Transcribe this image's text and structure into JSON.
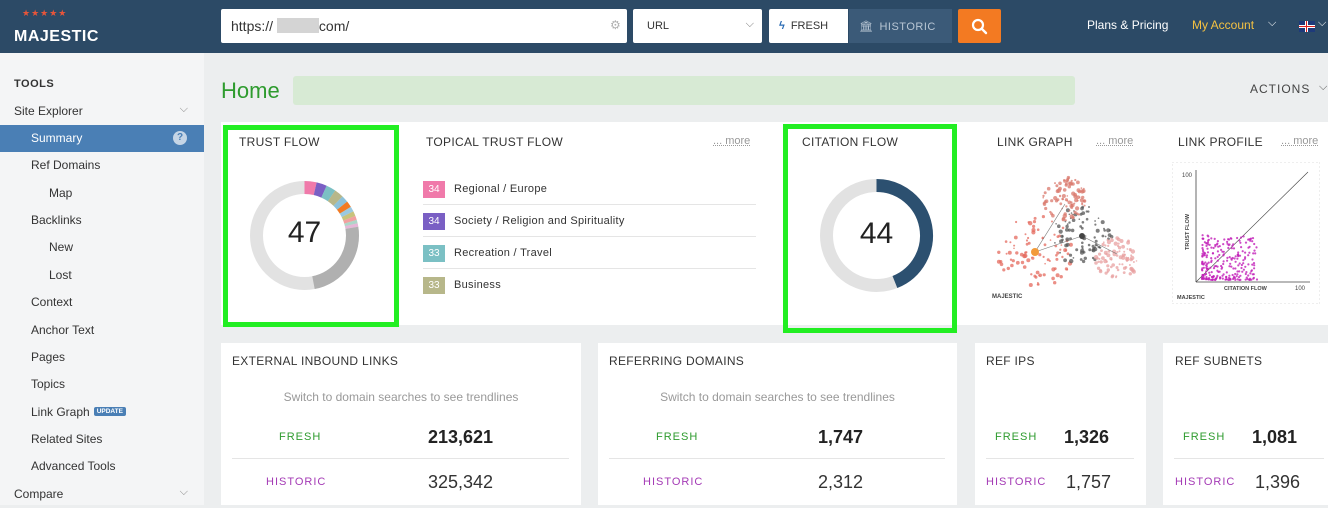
{
  "brand": {
    "name": "MAJESTIC"
  },
  "search": {
    "url_value": "https://           .com/",
    "url_prefix": "https://",
    "url_suffix": ".com/",
    "mode": "URL",
    "fresh_label": "FRESH",
    "historic_label": "HISTORIC"
  },
  "nav": {
    "plans": "Plans & Pricing",
    "account": "My Account"
  },
  "colors": {
    "topbar": "#2c4a66",
    "accent_orange": "#f37a22",
    "fresh_green": "#2e9b2e",
    "historic_purple": "#a43ab5",
    "active_blue": "#4a7fb5",
    "citation_navy": "#2c5070",
    "highlight": "#22ee22"
  },
  "sidebar": {
    "heading": "TOOLS",
    "items": [
      {
        "label": "Site Explorer"
      },
      {
        "label": "Summary"
      },
      {
        "label": "Ref Domains"
      },
      {
        "label": "Map"
      },
      {
        "label": "Backlinks"
      },
      {
        "label": "New"
      },
      {
        "label": "Lost"
      },
      {
        "label": "Context"
      },
      {
        "label": "Anchor Text"
      },
      {
        "label": "Pages"
      },
      {
        "label": "Topics"
      },
      {
        "label": "Link Graph",
        "badge": "UPDATE"
      },
      {
        "label": "Related Sites"
      },
      {
        "label": "Advanced Tools"
      },
      {
        "label": "Compare"
      }
    ]
  },
  "page": {
    "title": "Home",
    "actions": "ACTIONS"
  },
  "trust_flow": {
    "label": "TRUST FLOW",
    "value": "47"
  },
  "topical_trust_flow": {
    "label": "TOPICAL TRUST FLOW",
    "more": "... more",
    "items": [
      {
        "score": "34",
        "topic": "Regional / Europe",
        "color": "#f07aaa"
      },
      {
        "score": "34",
        "topic": "Society / Religion and Spirituality",
        "color": "#7a5fc4"
      },
      {
        "score": "33",
        "topic": "Recreation / Travel",
        "color": "#7bc0c4"
      },
      {
        "score": "33",
        "topic": "Business",
        "color": "#b7b78a"
      }
    ]
  },
  "citation_flow": {
    "label": "CITATION FLOW",
    "value": "44"
  },
  "link_graph": {
    "label": "LINK GRAPH",
    "more": "... more",
    "logo": "MAJESTIC"
  },
  "link_profile": {
    "label": "LINK PROFILE",
    "more": "... more",
    "y_label": "TRUST FLOW",
    "x_label": "CITATION FLOW",
    "y_max": "100",
    "x_max": "100",
    "logo": "MAJESTIC"
  },
  "stats": {
    "external_inbound_links": {
      "label": "EXTERNAL INBOUND LINKS",
      "trend": "Switch to domain searches to see trendlines",
      "fresh_label": "FRESH",
      "fresh": "213,621",
      "historic_label": "HISTORIC",
      "historic": "325,342"
    },
    "referring_domains": {
      "label": "REFERRING DOMAINS",
      "trend": "Switch to domain searches to see trendlines",
      "fresh_label": "FRESH",
      "fresh": "1,747",
      "historic_label": "HISTORIC",
      "historic": "2,312"
    },
    "ref_ips": {
      "label": "REF IPS",
      "fresh_label": "FRESH",
      "fresh": "1,326",
      "historic_label": "HISTORIC",
      "historic": "1,757"
    },
    "ref_subnets": {
      "label": "REF SUBNETS",
      "fresh_label": "FRESH",
      "fresh": "1,081",
      "historic_label": "HISTORIC",
      "historic": "1,396"
    }
  }
}
